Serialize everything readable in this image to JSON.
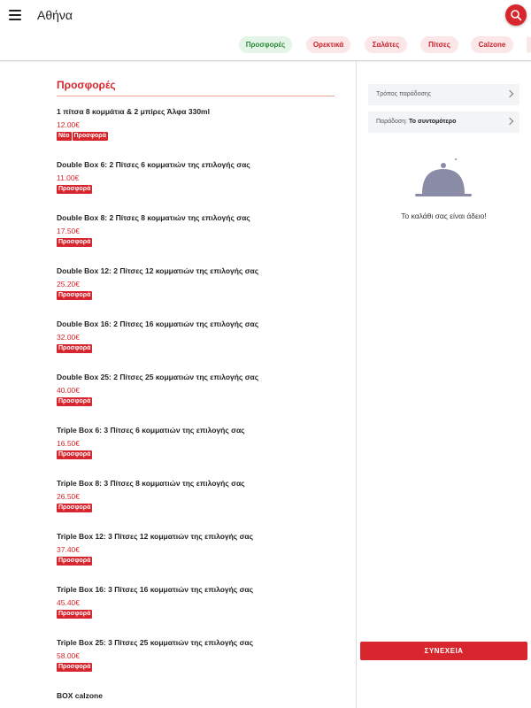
{
  "header": {
    "city": "Αθήνα",
    "icons": {
      "menu": "hamburger-menu-icon",
      "search": "search-icon"
    }
  },
  "categories": [
    {
      "label": "Προσφορές",
      "active": true
    },
    {
      "label": "Ορεκτικά",
      "active": false
    },
    {
      "label": "Σαλάτες",
      "active": false
    },
    {
      "label": "Πίτσες",
      "active": false
    },
    {
      "label": "Calzone",
      "active": false
    }
  ],
  "menu": {
    "section_title": "Προσφορές",
    "items": [
      {
        "name": "1 πίτσα 8 κομμάτια & 2 μπίρες Άλφα 330ml",
        "price": "12.00€",
        "badges": [
          "Νέο",
          "Προσφορά"
        ]
      },
      {
        "name": "Double Box 6: 2 Πίτσες 6 κομματιών της επιλογής σας",
        "price": "11.00€",
        "badges": [
          "Προσφορά"
        ]
      },
      {
        "name": "Double Box 8: 2 Πίτσες 8 κομματιών της επιλογής σας",
        "price": "17.50€",
        "badges": [
          "Προσφορά"
        ]
      },
      {
        "name": "Double Box 12: 2 Πίτσες 12 κομματιών της επιλογής σας",
        "price": "25.20€",
        "badges": [
          "Προσφορά"
        ]
      },
      {
        "name": "Double Box 16: 2 Πίτσες 16 κομματιών της επιλογής σας",
        "price": "32.00€",
        "badges": [
          "Προσφορά"
        ]
      },
      {
        "name": "Double Box 25: 2 Πίτσες 25 κομματιών της επιλογής σας",
        "price": "40.00€",
        "badges": [
          "Προσφορά"
        ]
      },
      {
        "name": "Triple Box 6: 3 Πίτσες 6 κομματιών της επιλογής σας",
        "price": "16.50€",
        "badges": [
          "Προσφορά"
        ]
      },
      {
        "name": "Triple Box 8: 3 Πίτσες 8 κομματιών της επιλογής σας",
        "price": "26.50€",
        "badges": [
          "Προσφορά"
        ]
      },
      {
        "name": "Triple Box 12: 3 Πίτσες 12 κομματιών της επιλογής σας",
        "price": "37.40€",
        "badges": [
          "Προσφορά"
        ]
      },
      {
        "name": "Triple Box 16: 3 Πίτσες 16 κομματιών της επιλογής σας",
        "price": "45.40€",
        "badges": [
          "Προσφορά"
        ]
      },
      {
        "name": "Triple Box 25: 3 Πίτσες 25 κομματιών της επιλογής σας",
        "price": "58.00€",
        "badges": [
          "Προσφορά"
        ]
      },
      {
        "name": "BOX calzone",
        "price": "",
        "badges": []
      }
    ]
  },
  "cart": {
    "delivery_method_label": "Τρόπος παράδοσης",
    "delivery_time_label": "Παράδοση:",
    "delivery_time_value": "Το συντομότερο",
    "empty_message": "Το καλάθι σας είναι άδειο!",
    "continue_label": "ΣΥΝΕΧΕΙΑ",
    "empty_icon": "food-cloche-icon"
  },
  "colors": {
    "brand_red": "#d7262d",
    "active_chip_green": "#2a8a3a"
  }
}
